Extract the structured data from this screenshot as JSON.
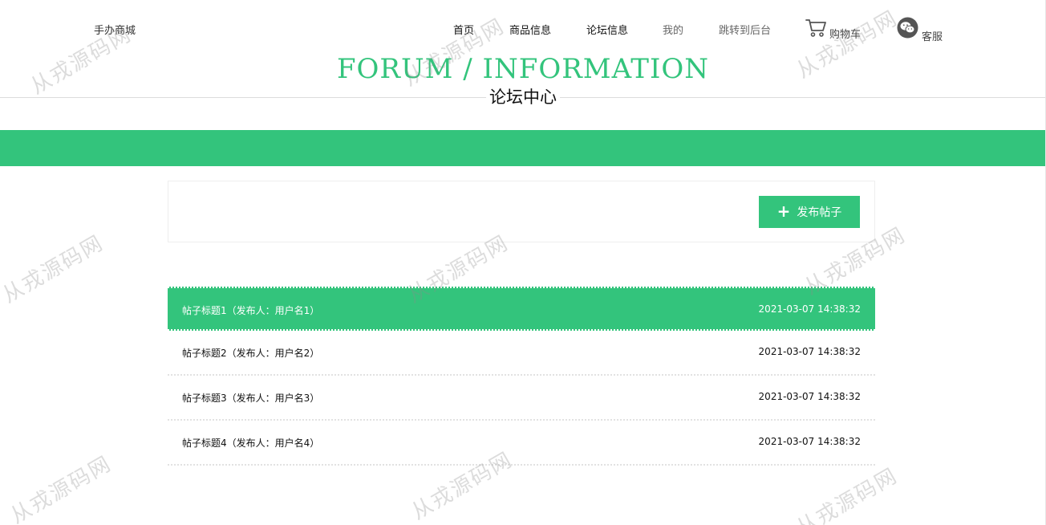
{
  "header": {
    "site_name": "手办商城",
    "nav": [
      "首页",
      "商品信息",
      "论坛信息",
      "我的",
      "跳转到后台"
    ],
    "cart_label": "购物车",
    "service_label": "客服"
  },
  "title": {
    "english": "FORUM / INFORMATION",
    "chinese": "论坛中心"
  },
  "actions": {
    "publish_label": "发布帖子",
    "publish_icon": "plus-icon"
  },
  "posts": [
    {
      "title": "帖子标题1（发布人：用户名1）",
      "time": "2021-03-07 14:38:32"
    },
    {
      "title": "帖子标题2（发布人：用户名2）",
      "time": "2021-03-07 14:38:32"
    },
    {
      "title": "帖子标题3（发布人：用户名3）",
      "time": "2021-03-07 14:38:32"
    },
    {
      "title": "帖子标题4（发布人：用户名4）",
      "time": "2021-03-07 14:38:32"
    }
  ],
  "watermark_text": "从戎源码网",
  "colors": {
    "accent": "#33c47c",
    "divider": "#dcdcdc"
  }
}
